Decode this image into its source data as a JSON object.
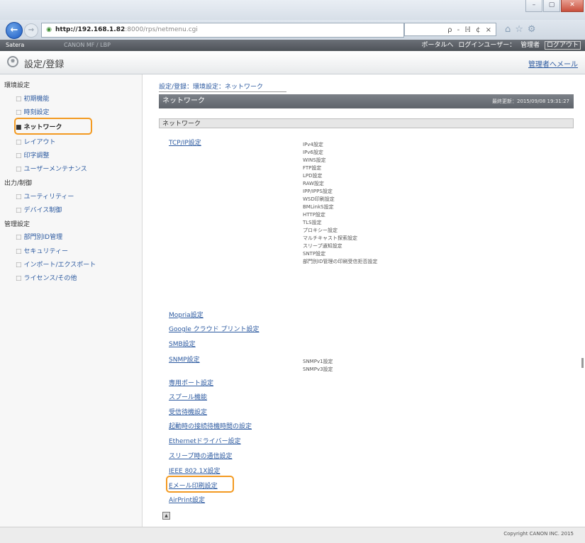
{
  "browser": {
    "url_host": "http://192.168.1.82",
    "url_rest": ":8000/rps/netmenu.cgi",
    "search_text": "ρ - ℍ ¢ ×",
    "window_buttons": [
      "–",
      "▢",
      "✕"
    ],
    "toolbar_icons": [
      "home-icon",
      "star-icon",
      "gear-icon"
    ]
  },
  "topbar": {
    "brand": "Satera",
    "host": "CANON MF / LBP",
    "portal": "ポータルへ",
    "login_user": "ログインユーザー：",
    "role": "管理者",
    "logout": "ログアウト"
  },
  "header": {
    "title": "設定/登録",
    "mail_admin": "管理者へメール"
  },
  "sidebar": {
    "categories": [
      {
        "label": "環境設定",
        "items": [
          {
            "label": "初期機能",
            "active": false
          },
          {
            "label": "時刻設定",
            "active": false
          },
          {
            "label": "ネットワーク",
            "active": true
          },
          {
            "label": "レイアウト",
            "active": false
          },
          {
            "label": "印字調整",
            "active": false
          },
          {
            "label": "ユーザーメンテナンス",
            "active": false
          }
        ]
      },
      {
        "label": "出力/制御",
        "items": [
          {
            "label": "ユーティリティー",
            "active": false
          },
          {
            "label": "デバイス制御",
            "active": false
          }
        ]
      },
      {
        "label": "管理設定",
        "items": [
          {
            "label": "部門別ID管理",
            "active": false
          },
          {
            "label": "セキュリティー",
            "active": false
          },
          {
            "label": "インポート/エクスポート",
            "active": false
          },
          {
            "label": "ライセンス/その他",
            "active": false
          }
        ]
      }
    ]
  },
  "main": {
    "breadcrumb": "設定/登録：環境設定：ネットワーク",
    "page_title": "ネットワーク",
    "last_updated": "最終更新：2015/09/08 19:31:27",
    "section_title": "ネットワーク",
    "tcpip_label": "TCP/IP設定",
    "tcpip_subitems": [
      "IPv4設定",
      "IPv6設定",
      "WINS設定",
      "FTP設定",
      "LPD設定",
      "RAW設定",
      "IPP/IPPS設定",
      "WSD印刷設定",
      "BMLinkS設定",
      "HTTP設定",
      "TLS設定",
      "プロキシー設定",
      "マルチキャスト探索設定",
      "スリープ通知設定",
      "SNTP設定",
      "部門別ID管理の印刷受信拒否設定"
    ],
    "links_mid": [
      "Mopria設定",
      "Google クラウド プリント設定",
      "SMB設定"
    ],
    "snmp_label": "SNMP設定",
    "snmp_subitems": [
      "SNMPv1設定",
      "SNMPv3設定"
    ],
    "links_bottom": [
      "専用ポート設定",
      "スプール機能",
      "受信待機設定",
      "起動時の接続待機時間の設定",
      "Ethernetドライバー設定",
      "スリープ時の通信設定",
      "IEEE 802.1X設定",
      "Eメール印刷設定",
      "AirPrint設定"
    ],
    "highlighted_link": "Eメール印刷設定"
  },
  "footer": {
    "copyright": "Copyright CANON INC. 2015"
  },
  "colors": {
    "highlight": "#f39a21",
    "link": "#2c5aa0",
    "header_bar": "#6c7178"
  }
}
